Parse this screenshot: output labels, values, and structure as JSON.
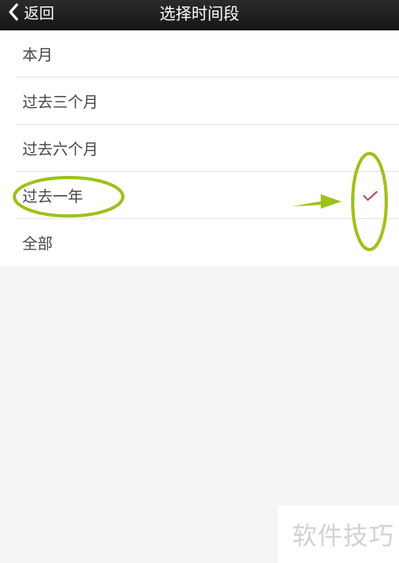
{
  "header": {
    "back_label": "返回",
    "title": "选择时间段"
  },
  "options": [
    {
      "label": "本月",
      "selected": false
    },
    {
      "label": "过去三个月",
      "selected": false
    },
    {
      "label": "过去六个月",
      "selected": false
    },
    {
      "label": "过去一年",
      "selected": true
    },
    {
      "label": "全部",
      "selected": false
    }
  ],
  "icons": {
    "back": "chevron-left-icon",
    "check": "checkmark-icon"
  },
  "colors": {
    "header_bg": "#1e1e1e",
    "check": "#c0506a",
    "annotation": "#9cc21a"
  },
  "watermark": "软件技巧"
}
